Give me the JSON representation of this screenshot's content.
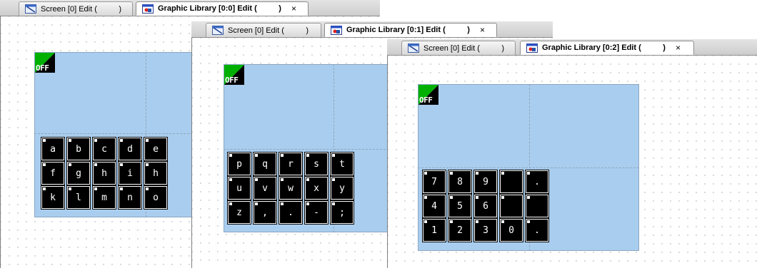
{
  "windows": [
    {
      "tabs": [
        {
          "label": "Screen [0] Edit (          )",
          "icon": "screen-icon"
        },
        {
          "label": "Graphic Library [0:0] Edit (          )",
          "icon": "graphic-library-icon",
          "close": "×"
        }
      ],
      "lamp_label": "OFF",
      "keys": [
        "a",
        "b",
        "c",
        "d",
        "e",
        "f",
        "g",
        "h",
        "i",
        "h",
        "k",
        "l",
        "m",
        "n",
        "o"
      ]
    },
    {
      "tabs": [
        {
          "label": "Screen [0] Edit (          )",
          "icon": "screen-icon"
        },
        {
          "label": "Graphic Library [0:1] Edit (          )",
          "icon": "graphic-library-icon",
          "close": "×"
        }
      ],
      "lamp_label": "OFF",
      "keys": [
        "p",
        "q",
        "r",
        "s",
        "t",
        "u",
        "v",
        "w",
        "x",
        "y",
        "z",
        ",",
        ".",
        "-",
        ";"
      ]
    },
    {
      "tabs": [
        {
          "label": "Screen [0] Edit (          )",
          "icon": "screen-icon"
        },
        {
          "label": "Graphic Library [0:2] Edit (          )",
          "icon": "graphic-library-icon",
          "close": "×"
        }
      ],
      "lamp_label": "OFF",
      "keys": [
        "7",
        "8",
        "9",
        "",
        ".",
        "4",
        "5",
        "6",
        "",
        "",
        "1",
        "2",
        "3",
        "0",
        "."
      ]
    }
  ],
  "colors": {
    "screen_area": "#a9cdee",
    "key_fill": "#000000",
    "lamp_green": "#00b000"
  }
}
